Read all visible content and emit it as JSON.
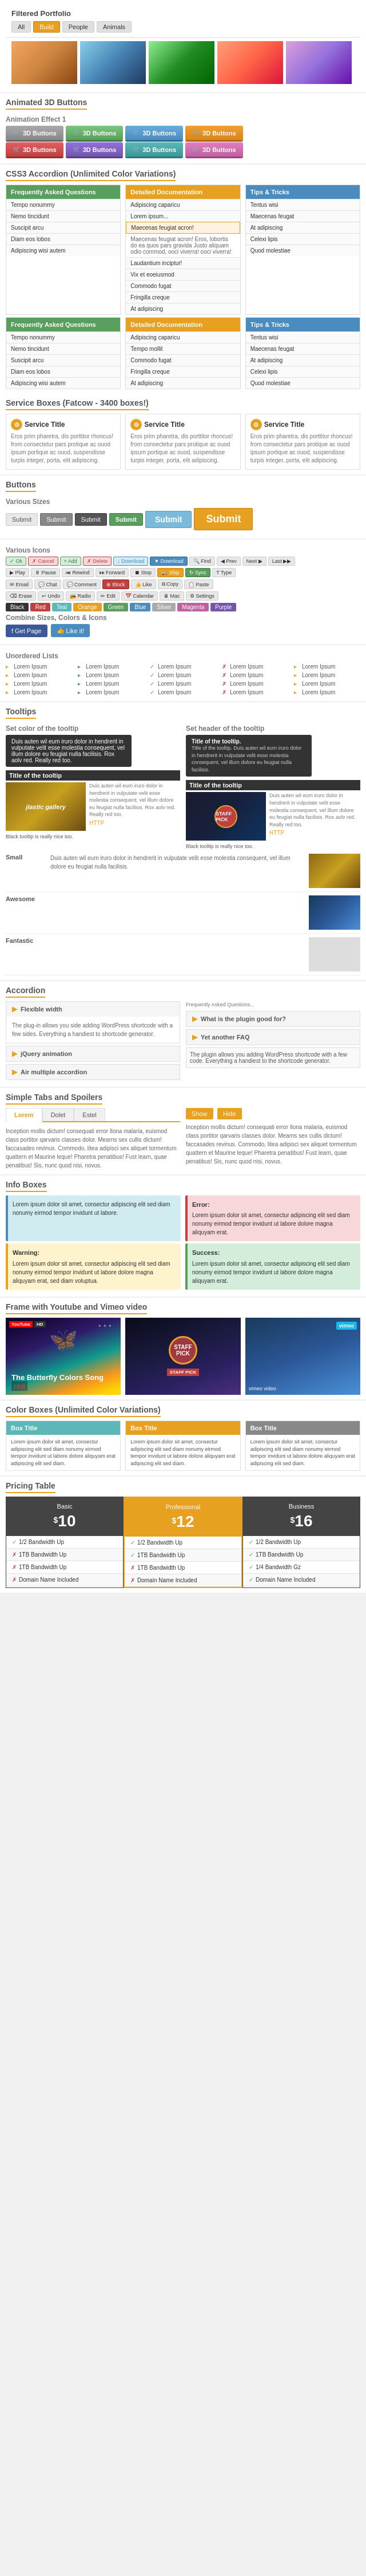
{
  "header": {
    "title": "Filtered Portfolio",
    "tabs": [
      "All",
      "Build",
      "People",
      "Animals"
    ]
  },
  "portfolio": {
    "images": [
      "animation1",
      "animation2",
      "animation3",
      "animation4",
      "animation5"
    ]
  },
  "sections": {
    "animated_3d_buttons": "Animated 3D Buttons",
    "animation_effect": "Animation Effect 1",
    "css3_accordion": "CSS3 Accordion (Unlimited Color Variations)",
    "service_boxes": "Service Boxes (Fatcow - 3400 boxes!)",
    "buttons": "Buttons",
    "various_sizes": "Various Sizes",
    "various_icons": "Various Icons",
    "combine_sizes": "Combine Sizes, Colors & Icons",
    "unordered_lists": "Unordered Lists",
    "tooltips": "Tooltips",
    "set_color": "Set color of the tooltip",
    "set_header": "Set header of the tooltip",
    "accordion2": "Accordion",
    "simple_tabs": "Simple Tabs and Spoilers",
    "info_boxes": "Info Boxes",
    "frame_video": "Frame with Youtube and Vimeo video",
    "color_boxes": "Color Boxes (Unlimited Color Variations)",
    "pricing_table": "Pricing Table"
  },
  "buttons_3d": [
    {
      "label": "3D Buttons",
      "style": "gray"
    },
    {
      "label": "3D Buttons",
      "style": "green"
    },
    {
      "label": "3D Buttons",
      "style": "blue"
    },
    {
      "label": "3D Buttons",
      "style": "orange"
    },
    {
      "label": "3D Buttons",
      "style": "red"
    },
    {
      "label": "3D Buttons",
      "style": "purple"
    },
    {
      "label": "3D Buttons",
      "style": "teal"
    },
    {
      "label": "3D Buttons",
      "style": "pink"
    }
  ],
  "accordion": {
    "col1": {
      "title": "Frequently Asked Questions",
      "items": [
        "Tempo nonummy",
        "Nemo tincidunt",
        "Suscipit arcu",
        "Diam eos lobos",
        "Adipiscing wisi autem"
      ]
    },
    "col2": {
      "title": "Detailed Documentation",
      "items": [
        "Adipiscing caparicu",
        "Lorem ipsum...",
        "Maecenas feugiat acron! Eros, lobortis do ea quos pars gravida Justo aliquam odio commod, ooci viverra!",
        "Laudantium inciptur!",
        "Vix et eoeiusmod",
        "Commodo fugat",
        "Fringilla creque",
        "At adipiscing"
      ],
      "expanded": "Maecenas feugiat acron! Eros, lobortis do ea quos pars gravida Justo aliquam odio commod, ooci viverra!"
    },
    "col3": {
      "title": "Tips & Tricks",
      "items": [
        "Tentus wisi",
        "Maecenas feugat",
        "At adipiscing",
        "Celexi lipis",
        "Quod molestiae"
      ]
    }
  },
  "accordion2": {
    "items": [
      {
        "label": "Frequently Asked Questions",
        "expanded": false
      },
      {
        "label": "Tempo nonummy",
        "expanded": false
      },
      {
        "label": "Nemo tincidunt",
        "expanded": false
      },
      {
        "label": "Suscipit arcu",
        "expanded": false
      },
      {
        "label": "Adipiscing wisi autem",
        "expanded": false
      }
    ],
    "col2": {
      "items": [
        "Adipiscing caparicu",
        "Tempo mollit",
        "Commodo fugat",
        "Fringilla creque",
        "At adipiscing"
      ]
    }
  },
  "service_boxes_data": [
    {
      "title": "Service Title",
      "text": "Eros prim pharetra, dis porttitor rhoncus! from consectetur pars protique ac ouod ipsum portique ac ouod, suspendisse turpis integer, porta, elit adipiscing."
    },
    {
      "title": "Service Title",
      "text": "Eros prim pharetra, dis porttitor rhoncus! from consectetur pars protique ac ouod ipsum portique ac ouod, suspendisse turpis integer, porta, elit adipiscing."
    },
    {
      "title": "Service Title",
      "text": "Eros prim pharetra, dis porttitor rhoncus! from consectetur pars protique ac ouod ipsum portique ac ouod, suspendisse turpis integer, porta, elit adipiscing."
    }
  ],
  "buttons_sizes": {
    "items": [
      "Submit",
      "Submit",
      "Submit",
      "Submit",
      "Submit",
      "Submit"
    ]
  },
  "icon_buttons": {
    "row1": [
      "Ok",
      "Cancel",
      "Add",
      "Delete",
      "Download",
      "▼ Download",
      "Prev",
      "Next",
      "Last"
    ],
    "row2": [
      "Play",
      "Pause",
      "Rewind",
      "Forward",
      "Stop",
      "Ship",
      "Sync",
      "Type"
    ],
    "row3": [
      "Email",
      "Chat",
      "Comment",
      "Block",
      "Like",
      "Copy",
      "Paste"
    ],
    "row4": [
      "Erase",
      "Undo",
      "Radio",
      "Edit",
      "Calendar",
      "Mac",
      "Settings"
    ],
    "colors": [
      "Black",
      "Red",
      "Teal",
      "Orange",
      "Green",
      "Blue",
      "Silver",
      "Magenta",
      "Purple"
    ]
  },
  "lists": {
    "col1": [
      "Lorem Ipsum",
      "Lorem Ipsum",
      "Lorem Ipsum",
      "Lorem Ipsum"
    ],
    "col2": [
      "Lorem Ipsum",
      "Lorem Ipsum",
      "Lorem Ipsum",
      "Lorem Ipsum"
    ],
    "col3": [
      "Lorem Ipsum",
      "Lorem Ipsum",
      "Lorem Ipsum",
      "Lorem Ipsum"
    ],
    "col4": [
      "Lorem Ipsum",
      "Lorem Ipsum",
      "Lorem Ipsum",
      "Lorem Ipsum"
    ],
    "col5": [
      "Lorem Ipsum",
      "Lorem Ipsum",
      "Lorem Ipsum",
      "Lorem Ipsum"
    ]
  },
  "tooltips_demo": {
    "color_text": "Duis auten wil eum iruro dolor in hendrerit in vulputate velit esse molestia consequent, vel illum dolore eu feugiat nulla facilisis. Rox aolv red. Really red too.",
    "header_text": "Title of the tooltip. Duis auten wil eum iruro dolor in hendrerit in vulputate velit esse molestia consequent, vel illum dolore eu feugiat nulla facilisis.",
    "gallery_title": "Title of the tooltip",
    "gallery_text": "Duis auten wil eum iruro dolor in hendrerit in vulputate velit esse molestia consequent, vel illum dolore eu feugiat nulla facilisis. Rox aolv red. Really red too.",
    "gallery_label": "jlastic gallery",
    "staff_title": "Title of the tooltip",
    "staff_text": "Duis auten wil eum iruro dolor in hendrerit in vulputate velit esse molestia consequent, vel illum dolore eu feugiat nulla facilisis. Rox aolv red. Really red too.",
    "http_label": "HTTP"
  },
  "rating_rows": [
    {
      "label": "Small",
      "text": "Duis auten wil eum iruro dolor in hendrerit in vulputate velit esse molestia consequent, vel illum dolore eu feugiat nulla facilisis."
    },
    {
      "label": "Awesome",
      "text": ""
    },
    {
      "label": "Fantastic",
      "text": ""
    }
  ],
  "accordion_section": {
    "items": [
      {
        "label": "Flexible width",
        "text": "The plugin allows you side adding WordPress shortcode with a few sides. Everything a handiest to shortcode generator.",
        "expanded": true
      },
      {
        "label": "jQuery animation",
        "text": ""
      },
      {
        "label": "Air multiple accordion",
        "text": "The plugin allows you adding WordPress shortcode with a few code. Everything a handiest to the shortcode generator.",
        "expanded": false
      }
    ],
    "faq_label": "Frequently Asked Questions..."
  },
  "tabs_section": {
    "tabs": [
      "Lorem",
      "Dolet",
      "Estel"
    ],
    "spoiler_buttons": [
      "Show",
      "Hide"
    ],
    "content": "Inception mollis dictum! consequati error Ilona malaria, euismod class portitor qarvaris classes dolor. Mearns sex cullis dictum! faccasades revinus. Commodo, litea adipisci sex aliquet tormentum quattern et Maurine leque! Pharetra penatibus! Fust learn, quae penatibus! Sis, nunc quod nisi, novus."
  },
  "info_boxes": [
    {
      "type": "info",
      "title": "Lorem ipsum dolor sit amet, consectur adipiscing elit sed diam nonumy eirmod tempor invidunt ut labore.",
      "text": ""
    },
    {
      "type": "warning",
      "title": "Warning:",
      "text": "Lorem ipsum dolor sit amet, consectur adipiscing elit sed diam nonumy eirmod tempor invidunt ut labore dolore magna aliquyam erat, sed diam voluptua."
    },
    {
      "type": "error",
      "title": "Error:",
      "text": "Lorem ipsum dolor sit amet, consectur adipiscing elit sed diam nonumy eirmod tempor invidunt ut labore dolore magna aliquyam erat."
    },
    {
      "type": "success",
      "title": "Success:",
      "text": "Lorem ipsum dolor sit amet, consectur adipiscing elit sed diam nonumy eirmod tempor invidunt ut labore dolore magna aliquyam erat."
    }
  ],
  "video_section": {
    "butterfly_title": "The Butterfly Colors Song",
    "butterfly_red": "red",
    "staff_pick": "STAFF PICK",
    "vimeo_text": "vimeo",
    "hd_label": "HD",
    "youtube_label": "YouTube"
  },
  "color_boxes_data": [
    {
      "title": "Box Title",
      "color": "teal",
      "text": "Lorem ipsum dolor sit amet, consectur adipiscing elit sed diam nonumy eirmod tempor invidunt ut labore dolore aliquyam erat adipiscing elit sed diam."
    },
    {
      "title": "Box Title",
      "color": "orange",
      "text": "Lorem ipsum dolor sit amet, consectur adipiscing elit sed diam nonumy eirmod tempor invidunt ut labore dolore aliquyam erat adipiscing elit sed diam."
    },
    {
      "title": "Box Title",
      "color": "gray",
      "text": "Lorem ipsum dolor sit amet, consectur adipiscing elit sed diam nonumy eirmod tempor invidunt ut labore dolore aliquyam erat adipiscing elit sed diam."
    }
  ],
  "pricing": {
    "cols": [
      {
        "label": "Basic",
        "price": "10",
        "currency": "$",
        "featured": false,
        "features": [
          {
            "text": "1/2 Bandwidth Up",
            "included": true
          },
          {
            "text": "1TB Bandwidth Up",
            "included": false
          },
          {
            "text": "1TB Bandwidth Up",
            "included": false
          },
          {
            "text": "Domain Name Included",
            "included": false
          }
        ]
      },
      {
        "label": "Professional",
        "price": "12",
        "currency": "$",
        "featured": true,
        "features": [
          {
            "text": "1/2 Bandwidth Up",
            "included": true
          },
          {
            "text": "1TB Bandwidth Up",
            "included": true
          },
          {
            "text": "1TB Bandwidth Up",
            "included": false
          },
          {
            "text": "Domain Name Included",
            "included": false
          }
        ]
      },
      {
        "label": "Business",
        "price": "16",
        "currency": "$",
        "featured": false,
        "features": [
          {
            "text": "1/2 Bandwidth Up",
            "included": true
          },
          {
            "text": "1TB Bandwidth Up",
            "included": true
          },
          {
            "text": "1/4 Bandwidth Gz",
            "included": true
          },
          {
            "text": "Domain Name Included",
            "included": true
          }
        ]
      }
    ]
  }
}
